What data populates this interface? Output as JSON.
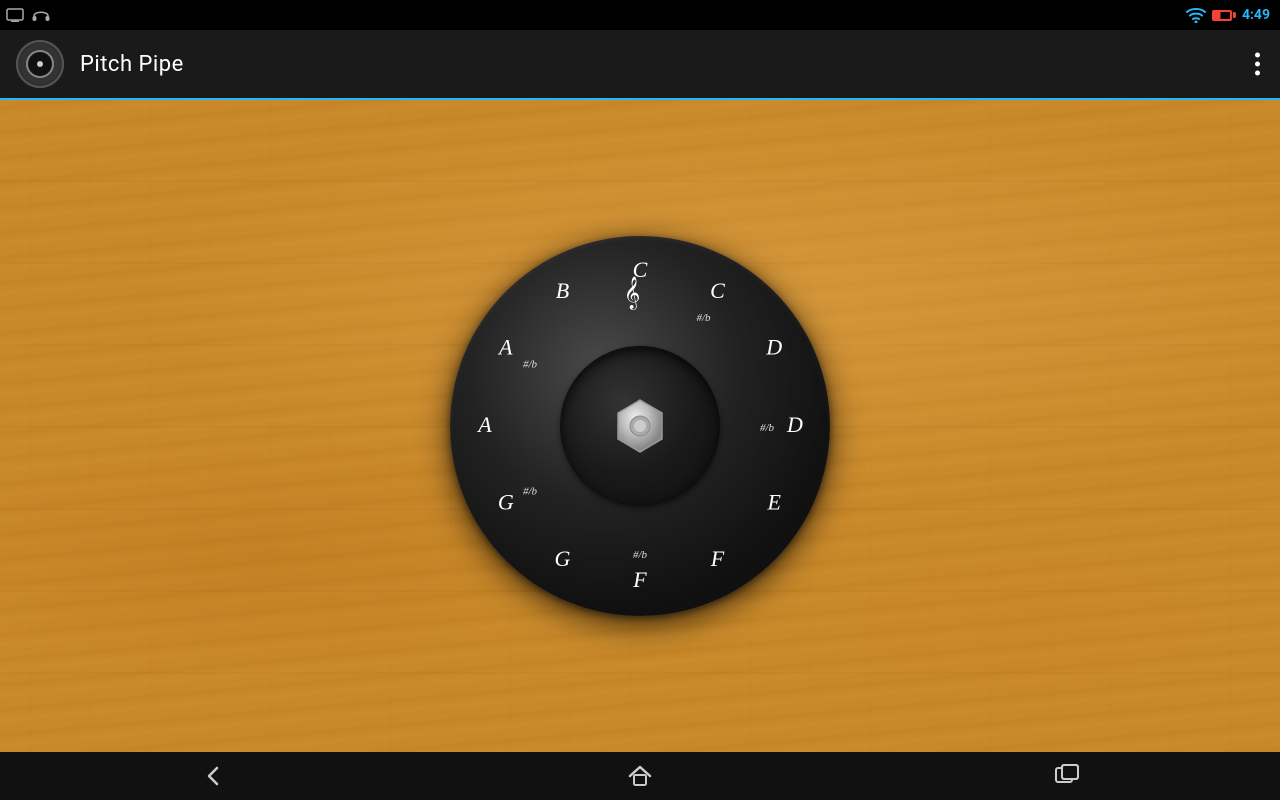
{
  "statusBar": {
    "time": "4:49",
    "icons": {
      "monitor": "monitor-icon",
      "headphone": "headphone-icon",
      "wifi": "wifi-icon",
      "battery": "battery-icon"
    }
  },
  "appBar": {
    "title": "Pitch Pipe",
    "overflowMenu": "more-options"
  },
  "pitchWheel": {
    "notes": [
      {
        "main": "C",
        "alt": "",
        "angle": 0
      },
      {
        "main": "C",
        "alt": "#/b",
        "angle": 30
      },
      {
        "main": "D",
        "alt": "",
        "angle": 60
      },
      {
        "main": "D",
        "alt": "#/b",
        "angle": 90
      },
      {
        "main": "E",
        "alt": "",
        "angle": 120
      },
      {
        "main": "F",
        "alt": "",
        "angle": 150
      },
      {
        "main": "F",
        "alt": "#/b",
        "angle": 180
      },
      {
        "main": "G",
        "alt": "",
        "angle": 210
      },
      {
        "main": "G",
        "alt": "#/b",
        "angle": 240
      },
      {
        "main": "A",
        "alt": "",
        "angle": 270
      },
      {
        "main": "A",
        "alt": "#/b",
        "angle": 300
      },
      {
        "main": "B",
        "alt": "",
        "angle": 330
      }
    ]
  },
  "navBar": {
    "back": "←",
    "home": "home",
    "recent": "recent"
  }
}
